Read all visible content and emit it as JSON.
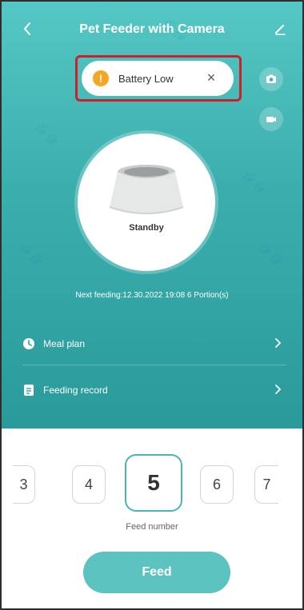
{
  "header": {
    "title": "Pet Feeder with Camera"
  },
  "alert": {
    "text": "Battery Low",
    "close_label": "×"
  },
  "device": {
    "status": "Standby"
  },
  "schedule": {
    "next_feeding": "Next feeding:12.30.2022 19:08 6 Portion(s)"
  },
  "menu": {
    "meal_plan": "Meal plan",
    "feeding_record": "Feeding record"
  },
  "portions": {
    "options": [
      "3",
      "4",
      "5",
      "6",
      "7"
    ],
    "selected": "5",
    "label": "Feed number"
  },
  "actions": {
    "feed_label": "Feed"
  },
  "colors": {
    "teal": "#3aaead",
    "alert_border": "#c8232b",
    "warning": "#f5a623",
    "feed_button": "#5cc3c0"
  }
}
